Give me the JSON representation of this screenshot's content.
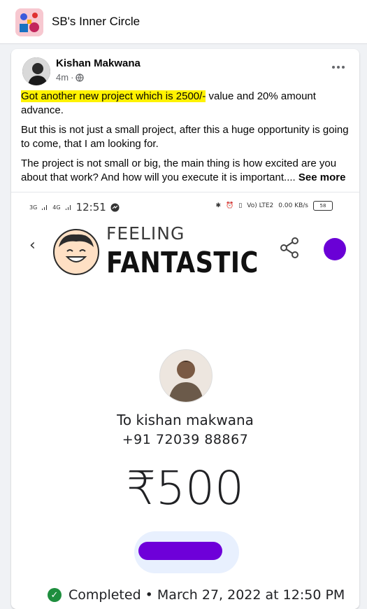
{
  "group": {
    "name": "SB's Inner Circle"
  },
  "post": {
    "author": "Kishan Makwana",
    "time": "4m",
    "audience_icon": "globe-icon",
    "menu_icon": "more-horizontal-icon",
    "highlight_text": "Got another new project which is 2500/-",
    "paragraph1_rest": " value and 20% amount advance.",
    "paragraph2": "But this is not just a small project, after this a huge opportunity is going to come, that I am looking for.",
    "paragraph3": "The project is not small or big, the main thing is how excited are you about that work? And how will you execute it is important....",
    "see_more": "See more",
    "highlight_color": "#fff200"
  },
  "screenshot": {
    "status_time": "12:51",
    "network1": "3G",
    "network2": "4G",
    "status_volte": "Vo) LTE2",
    "status_speed": "0.00 KB/s",
    "battery": "58",
    "sticker_line1": "FEELING",
    "sticker_line2": "FANTASTIC",
    "recipient": "To kishan makwana",
    "phone": "+91 72039 88867",
    "amount": "₹500",
    "status": "Completed • March 27, 2022 at 12:50 PM",
    "accent_purple": "#6a00d6",
    "status_green": "#1e8e3e"
  }
}
